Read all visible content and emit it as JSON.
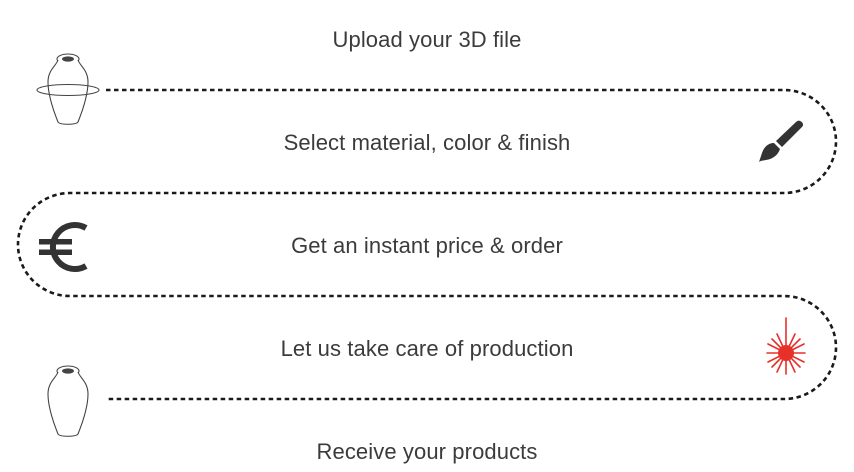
{
  "steps": [
    {
      "label": "Upload your 3D file",
      "icon": "vase-rotate-icon"
    },
    {
      "label": "Select material, color & finish",
      "icon": "paintbrush-icon"
    },
    {
      "label": "Get an instant price & order",
      "icon": "euro-icon"
    },
    {
      "label": "Let us take care of production",
      "icon": "laser-icon"
    },
    {
      "label": "Receive your products",
      "icon": "vase-icon"
    }
  ],
  "colors": {
    "text": "#3b3b3b",
    "path": "#1a1a1a",
    "icon_dark": "#333333",
    "laser": "#e8302a"
  }
}
